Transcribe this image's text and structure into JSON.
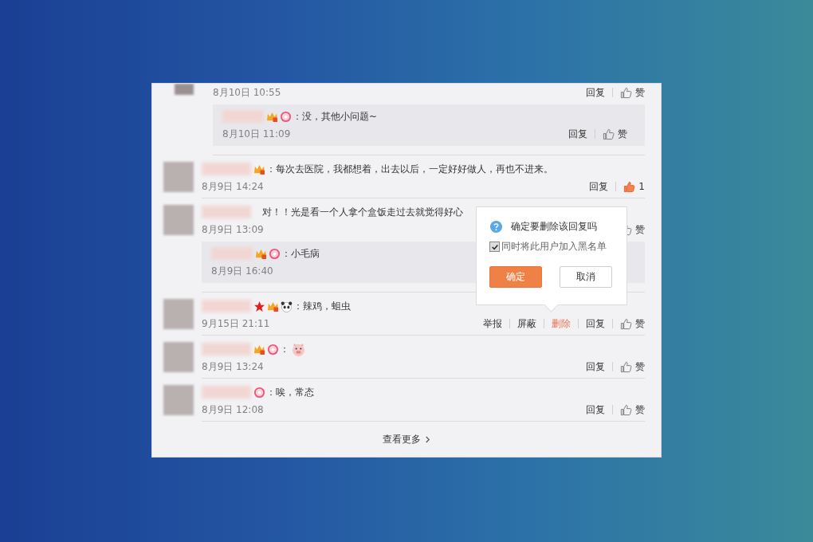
{
  "comments": [
    {
      "time": "8月10日 10:55",
      "actions": [
        {
          "label": "回复",
          "highlighted": false
        }
      ],
      "like": "赞",
      "liked": false,
      "replies": [
        {
          "badges": [
            {
              "kind": "vip"
            },
            {
              "kind": "donut"
            }
          ],
          "text": "：没，其他小问题~",
          "time": "8月10日 11:09",
          "actions": [
            {
              "label": "回复",
              "highlighted": false
            }
          ],
          "like": "赞"
        }
      ]
    },
    {
      "badges": [
        {
          "kind": "vip"
        }
      ],
      "text": "：每次去医院，我都想着，出去以后，一定好好做人，再也不进来。",
      "time": "8月9日 14:24",
      "actions": [
        {
          "label": "回复",
          "highlighted": false
        }
      ],
      "like": "1",
      "liked": true
    },
    {
      "text": "对！！光是看一个人拿个盒饭走过去就觉得好心",
      "time": "8月9日 13:09",
      "like": "赞",
      "liked": false,
      "replies": [
        {
          "badges": [
            {
              "kind": "vip"
            },
            {
              "kind": "donut"
            }
          ],
          "text": "：小毛病",
          "time": "8月9日 16:40"
        }
      ]
    },
    {
      "badges": [
        {
          "kind": "star"
        },
        {
          "kind": "vip"
        },
        {
          "kind": "panda"
        }
      ],
      "text": "：辣鸡，蛆虫",
      "time": "9月15日 21:11",
      "actions": [
        {
          "label": "举报",
          "highlighted": false
        },
        {
          "label": "屏蔽",
          "highlighted": false
        },
        {
          "label": "删除",
          "highlighted": true
        },
        {
          "label": "回复",
          "highlighted": false
        }
      ],
      "like": "赞",
      "liked": false
    },
    {
      "badges": [
        {
          "kind": "vip"
        },
        {
          "kind": "donut"
        }
      ],
      "text": "：",
      "emoji": {
        "kind": "pig"
      },
      "time": "8月9日 13:24",
      "actions": [
        {
          "label": "回复",
          "highlighted": false
        }
      ],
      "like": "赞",
      "liked": false
    },
    {
      "badges": [
        {
          "kind": "donut"
        }
      ],
      "text": "：唉，常态",
      "time": "8月9日 12:08",
      "actions": [
        {
          "label": "回复",
          "highlighted": false
        }
      ],
      "like": "赞",
      "liked": false
    }
  ],
  "more": {
    "label": "查看更多"
  },
  "confirm_popup": {
    "message": "确定要删除该回复吗",
    "checkbox": {
      "label": "同时将此用户加入黑名单",
      "checked": true
    },
    "buttons": [
      {
        "label": "确定",
        "kind": "primary"
      },
      {
        "label": "取消",
        "kind": "secondary"
      }
    ]
  }
}
